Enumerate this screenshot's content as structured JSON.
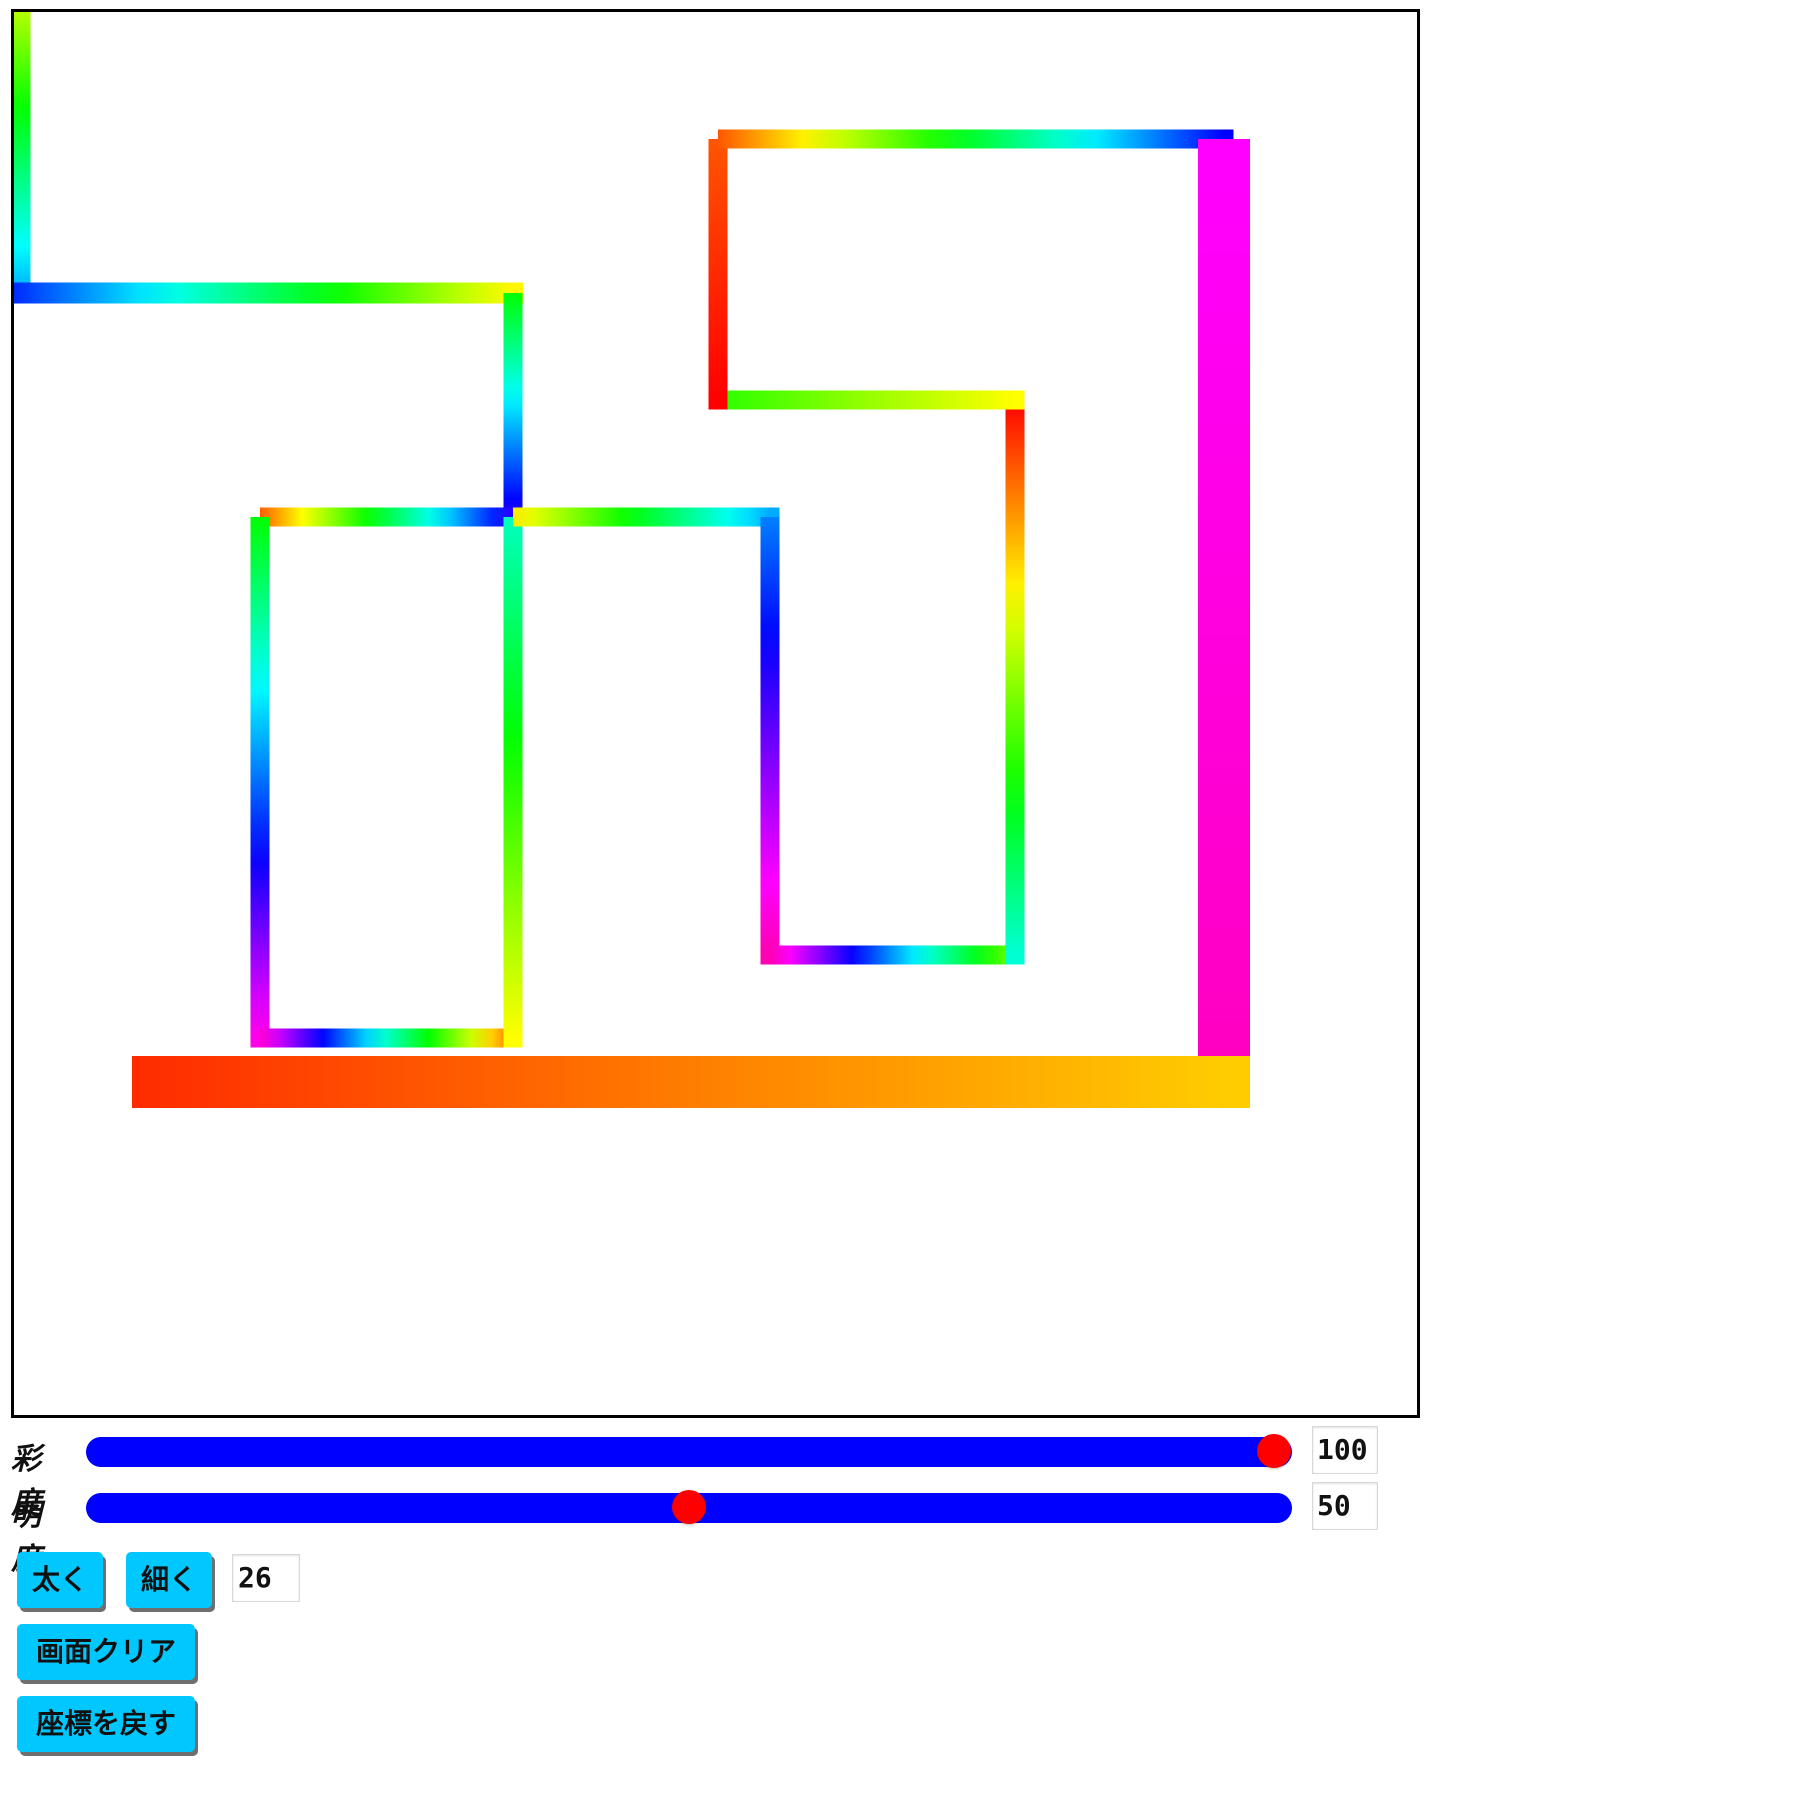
{
  "drawing": {
    "segments": [
      {
        "h1": 78,
        "h2": 200
      },
      {
        "h1": 230,
        "h2": 58
      },
      {
        "h1": 120,
        "h2": 250
      },
      {
        "h1": 250,
        "h2": 22
      },
      {
        "h1": 120,
        "h2": 305
      },
      {
        "h1": 310,
        "h2": 25
      },
      {
        "h1": 60,
        "h2": 165
      },
      {
        "h1": 55,
        "h2": 200
      },
      {
        "h1": 210,
        "h2": 318
      },
      {
        "h1": 318,
        "h2": 90
      },
      {
        "h1": 170,
        "h2": 0
      },
      {
        "h1": 60,
        "h2": 110
      },
      {
        "h1": 0,
        "h2": 20
      },
      {
        "h1": 20,
        "h2": 240
      },
      {
        "h1": 300,
        "h2": 315
      },
      {
        "h1": 48,
        "h2": 10
      },
      {
        "h1": 195,
        "h2": 720
      }
    ]
  },
  "controls": {
    "saturation": {
      "label": "彩度",
      "value": "100",
      "fraction": 0.985
    },
    "lightness": {
      "label": "明度",
      "value": "50",
      "fraction": 0.5
    },
    "thicker_label": "太く",
    "thinner_label": "細く",
    "line_width": "26",
    "clear_label": "画面クリア",
    "undo_label": "座標を戻す"
  },
  "colors": {
    "track": "#0000ff",
    "thumb": "#ff0000",
    "button": "#00c8ff"
  }
}
